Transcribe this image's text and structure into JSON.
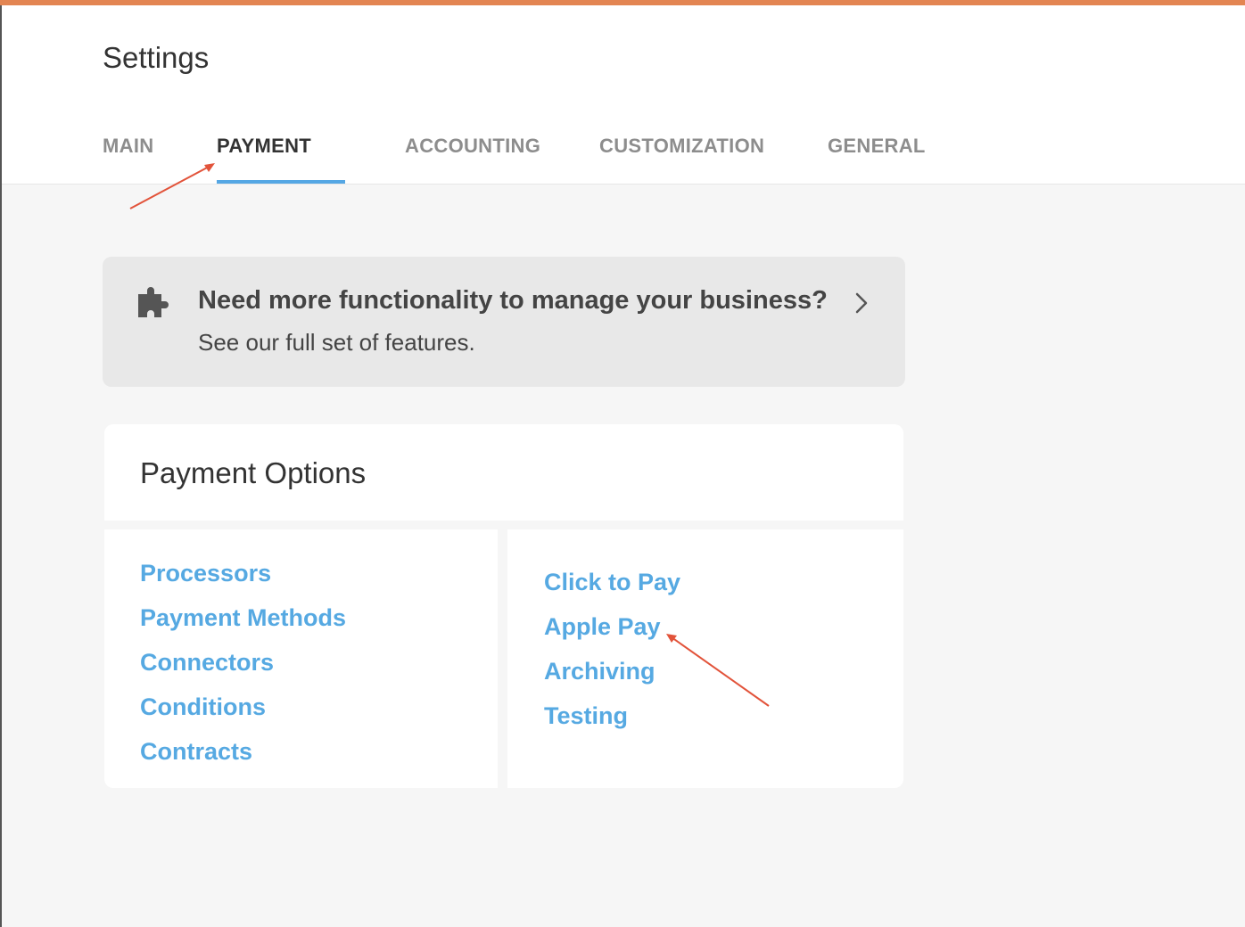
{
  "page": {
    "title": "Settings"
  },
  "tabs": [
    {
      "label": "MAIN",
      "active": false
    },
    {
      "label": "PAYMENT",
      "active": true
    },
    {
      "label": "ACCOUNTING",
      "active": false
    },
    {
      "label": "CUSTOMIZATION",
      "active": false
    },
    {
      "label": "GENERAL",
      "active": false
    }
  ],
  "banner": {
    "icon": "puzzle-icon",
    "heading": "Need more functionality to manage your business?",
    "subtext": "See our full set of features.",
    "action_icon": "chevron-right-icon"
  },
  "payment_options": {
    "title": "Payment Options",
    "left_links": [
      "Processors",
      "Payment Methods",
      "Connectors",
      "Conditions",
      "Contracts"
    ],
    "right_links": [
      "Click to Pay",
      "Apple Pay",
      "Archiving",
      "Testing"
    ]
  },
  "colors": {
    "accent_top": "#e38552",
    "link": "#56a9e2",
    "active_tab_underline": "#55a7e4",
    "annotation_arrow": "#e2533a"
  }
}
